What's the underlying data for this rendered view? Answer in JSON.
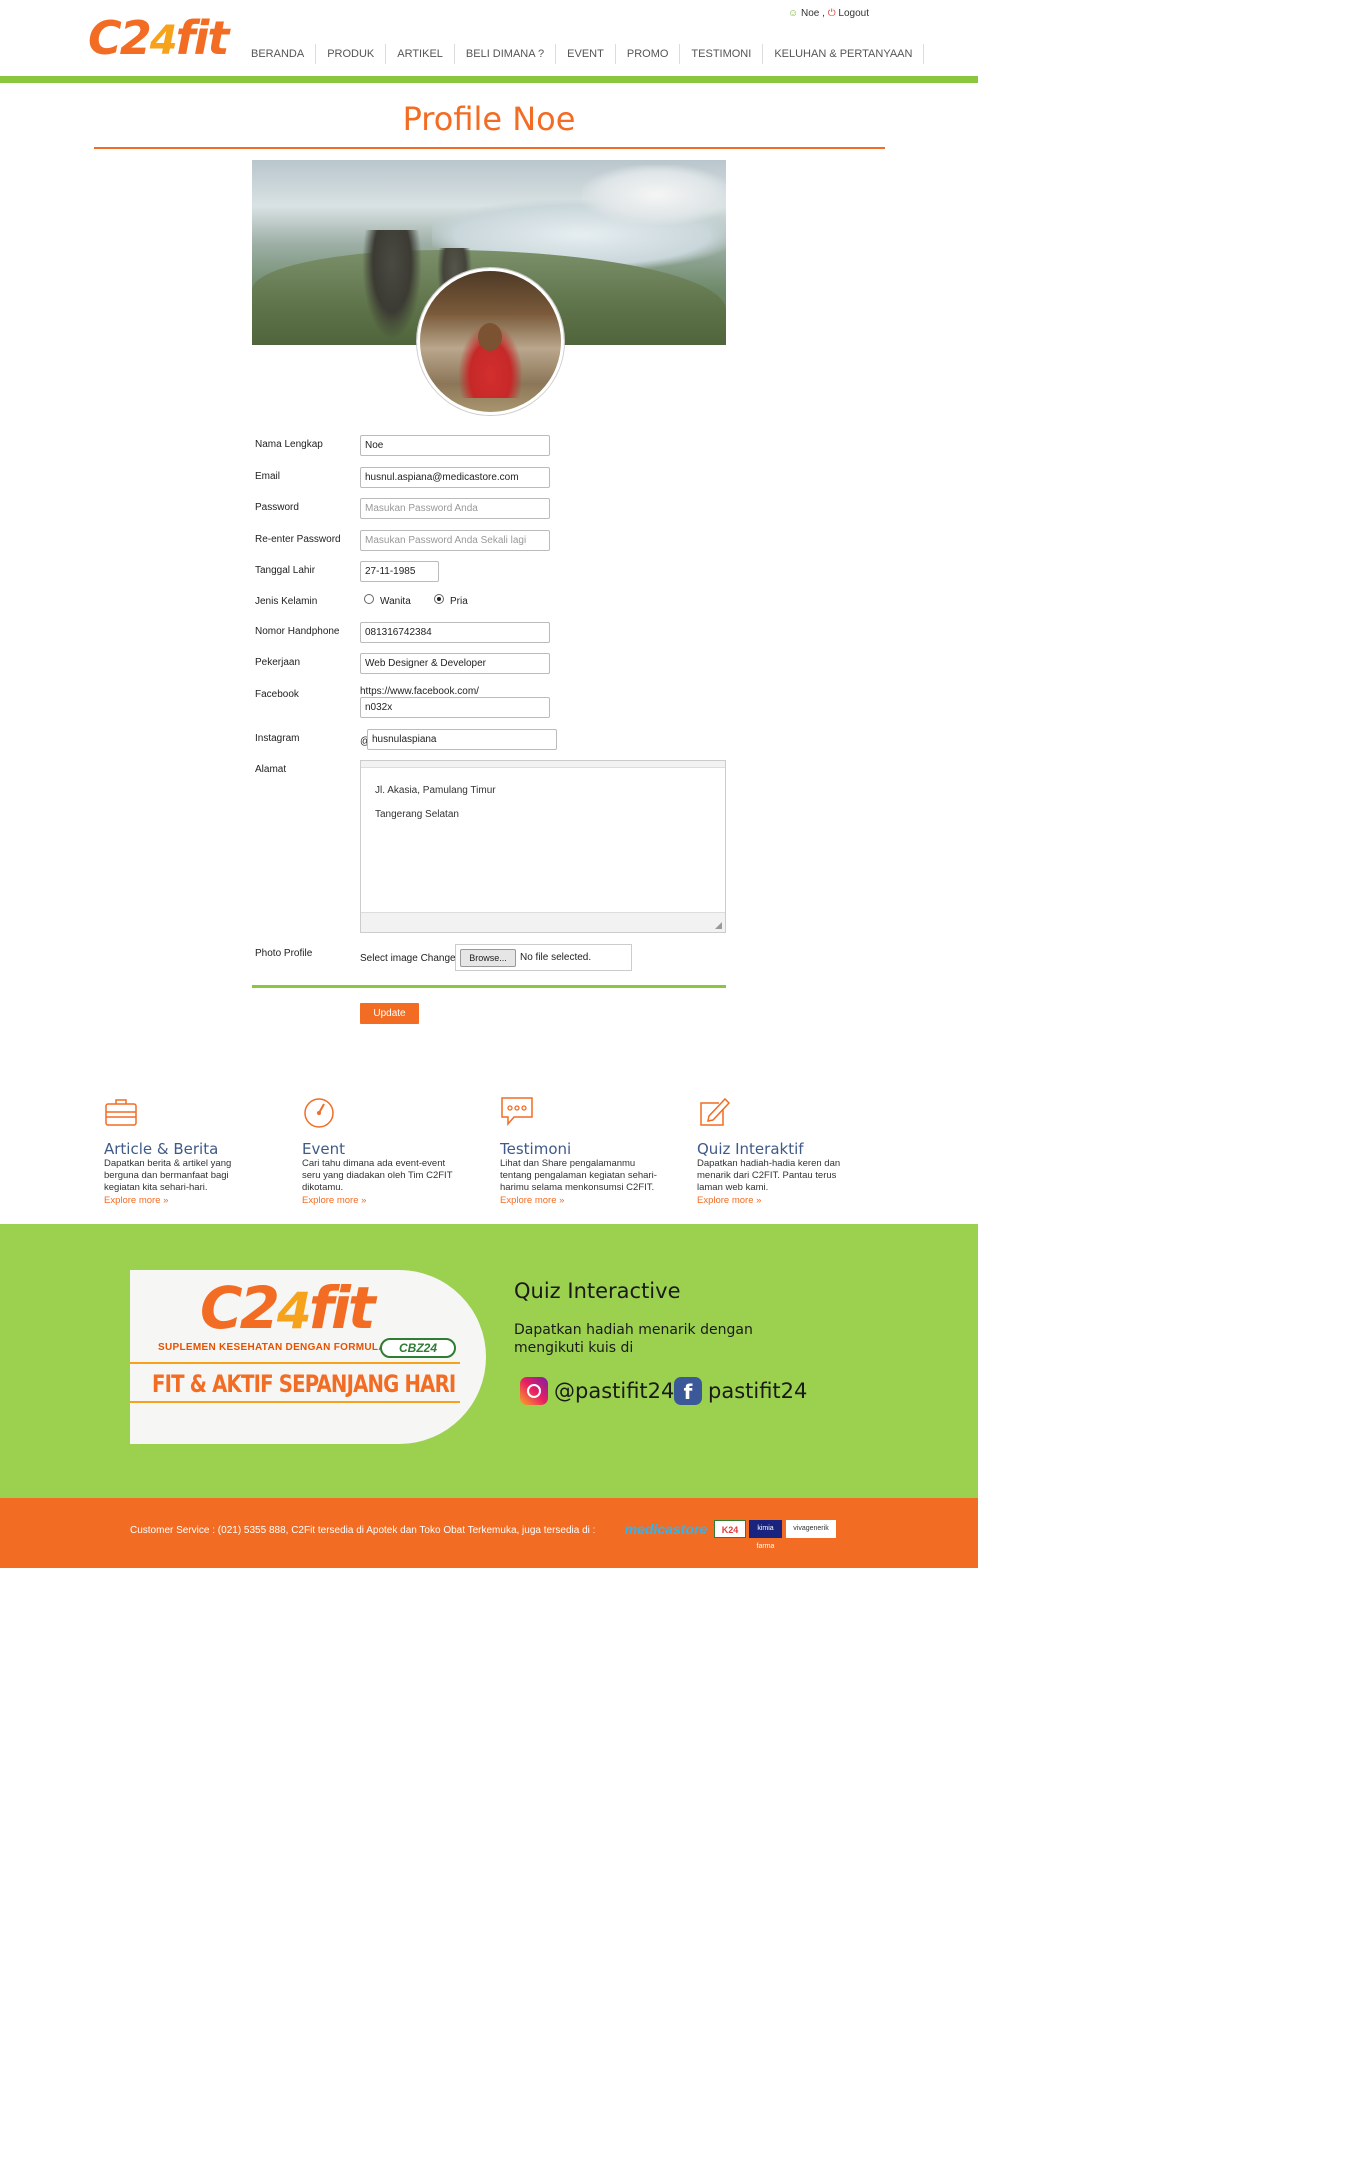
{
  "header": {
    "logo_text": "C2",
    "logo_four": "4",
    "logo_fit": "fit",
    "user_name": "Noe",
    "separator": ",",
    "logout_label": "Logout",
    "nav": [
      "BERANDA",
      "PRODUK",
      "ARTIKEL",
      "BELI DIMANA ?",
      "EVENT",
      "PROMO",
      "TESTIMONI",
      "KELUHAN & PERTANYAAN"
    ]
  },
  "page": {
    "title": "Profile Noe"
  },
  "form": {
    "full_name_label": "Nama Lengkap",
    "full_name_value": "Noe",
    "email_label": "Email",
    "email_value": "husnul.aspiana@medicastore.com",
    "password_label": "Password",
    "password_placeholder": "Masukan Password Anda",
    "reenter_label": "Re-enter Password",
    "reenter_placeholder": "Masukan Password Anda Sekali lagi",
    "birthdate_label": "Tanggal Lahir",
    "birthdate_value": "27-11-1985",
    "gender_label": "Jenis Kelamin",
    "gender_female": "Wanita",
    "gender_male": "Pria",
    "gender_selected": "Pria",
    "phone_label": "Nomor Handphone",
    "phone_value": "081316742384",
    "job_label": "Pekerjaan",
    "job_value": "Web Designer & Developer",
    "facebook_label": "Facebook",
    "facebook_prefix": "https://www.facebook.com/",
    "facebook_value": "n032x",
    "instagram_label": "Instagram",
    "instagram_prefix": "@",
    "instagram_value": "husnulaspiana",
    "address_label": "Alamat",
    "address_line1": "Jl. Akasia, Pamulang Timur",
    "address_line2": "Tangerang Selatan",
    "photo_label": "Photo Profile",
    "photo_select_text": "Select image Change",
    "browse_label": "Browse...",
    "file_status": "No file selected.",
    "update_label": "Update"
  },
  "features": [
    {
      "title": "Article & Berita",
      "desc": "Dapatkan berita & artikel yang berguna dan bermanfaat bagi kegiatan kita sehari-hari.",
      "more": "Explore more »",
      "icon": "briefcase-icon"
    },
    {
      "title": "Event",
      "desc": "Cari tahu dimana ada event-event seru yang diadakan oleh Tim C2FIT dikotamu.",
      "more": "Explore more »",
      "icon": "speedometer-icon"
    },
    {
      "title": "Testimoni",
      "desc": "Lihat dan Share pengalamanmu tentang pengalaman kegiatan sehari-harimu selama menkonsumsi C2FIT.",
      "more": "Explore more »",
      "icon": "chat-bubble-icon"
    },
    {
      "title": "Quiz Interaktif",
      "desc": "Dapatkan hadiah-hadia keren dan menarik dari C2FIT. Pantau terus laman web kami.",
      "more": "Explore more »",
      "icon": "edit-icon"
    }
  ],
  "promo": {
    "banner_logo": "C2",
    "banner_four": "4",
    "banner_fit": "fit",
    "banner_subtitle": "SUPLEMEN KESEHATAN DENGAN FORMULA",
    "banner_badge": "CBZ24",
    "banner_tagline": "FIT & AKTIF SEPANJANG HARI",
    "quiz_title": "Quiz Interactive",
    "quiz_desc": "Dapatkan hadiah menarik dengan mengikuti kuis di",
    "instagram_handle": "@pastifit24",
    "facebook_handle": "pastifit24",
    "facebook_glyph": "f"
  },
  "footer": {
    "text": "Customer Service : (021) 5355 888, C2Fit tersedia di Apotek dan Toko Obat Terkemuka, juga tersedia di :",
    "partners": [
      "medicastore",
      "K24",
      "kimia farma",
      "vivagenerik"
    ]
  },
  "colors": {
    "brand_orange": "#f26c23",
    "brand_green": "#8cc63f",
    "band_green": "#9bd14e",
    "feature_title_blue": "#3f5a8a"
  }
}
